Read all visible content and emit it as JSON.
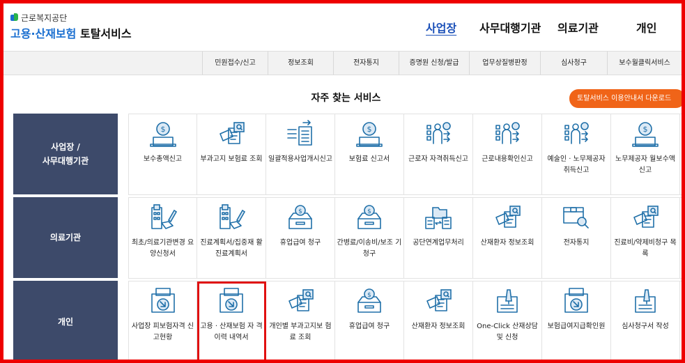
{
  "header": {
    "org": "근로복지공단",
    "service_blue": "고용·산재보험",
    "service_dark": "토탈서비스",
    "nav": [
      {
        "label": "사업장",
        "active": true
      },
      {
        "label": "사무대행기관",
        "active": false
      },
      {
        "label": "의료기관",
        "active": false
      },
      {
        "label": "개인",
        "active": false
      }
    ]
  },
  "subnav": [
    "민원접수/신고",
    "정보조회",
    "전자통지",
    "증명원 신청/발급",
    "업무상질병판정",
    "심사청구",
    "보수월클릭서비스"
  ],
  "frequent": {
    "title": "자주 찾는 서비스",
    "download_label": "토탈서비스 이용안내서 다운로드"
  },
  "colors": {
    "accent_orange": "#f06418",
    "category_bg": "#3d4a6a",
    "icon_blue": "#1f6fa8",
    "highlight_red": "#e01010"
  },
  "rows": [
    {
      "category": "사업장 /\n사무대행기관",
      "items": [
        {
          "label": "보수총액신고",
          "icon": "money-box-icon"
        },
        {
          "label": "부과고지 보험료 조회",
          "icon": "document-search-icon"
        },
        {
          "label": "일괄적용사업개시신고",
          "icon": "document-transfer-icon"
        },
        {
          "label": "보험료 신고서",
          "icon": "money-box-icon"
        },
        {
          "label": "근로자 자격취득신고",
          "icon": "person-list-icon"
        },
        {
          "label": "근로내용확인신고",
          "icon": "person-list-icon"
        },
        {
          "label": "예술인 · 노무제공자 취득신고",
          "icon": "person-list-icon"
        },
        {
          "label": "노무제공자 월보수액 신고",
          "icon": "money-box-icon"
        }
      ]
    },
    {
      "category": "의료기관",
      "items": [
        {
          "label": "최초/의료기관변경 요양신청서",
          "icon": "hospital-form-icon"
        },
        {
          "label": "진료계획서/집중재 활진료계획서",
          "icon": "hospital-form-icon"
        },
        {
          "label": "휴업급여 청구",
          "icon": "coin-tray-icon"
        },
        {
          "label": "간병료/이송비/보조 기 청구",
          "icon": "coin-tray-icon"
        },
        {
          "label": "공단연계업무처리",
          "icon": "folder-exchange-icon"
        },
        {
          "label": "산재환자 정보조회",
          "icon": "document-search-icon"
        },
        {
          "label": "전자통지",
          "icon": "box-search-icon"
        },
        {
          "label": "진료비/약제비청구 목록",
          "icon": "document-search-icon"
        }
      ]
    },
    {
      "category": "개인",
      "items": [
        {
          "label": "사업장 피보험자격 신고현황",
          "icon": "printer-download-icon"
        },
        {
          "label": "고용 · 산재보험 자 격 이력 내역서",
          "icon": "printer-download-icon",
          "highlighted": true
        },
        {
          "label": "개인별 부과고지보 험료 조회",
          "icon": "document-search-icon"
        },
        {
          "label": "휴업급여 청구",
          "icon": "coin-tray-icon"
        },
        {
          "label": "산재환자 정보조회",
          "icon": "document-search-icon"
        },
        {
          "label": "One-Click 산재상담 및 신청",
          "icon": "pen-document-icon"
        },
        {
          "label": "보험급여지급확인원",
          "icon": "printer-download-icon"
        },
        {
          "label": "심사청구서 작성",
          "icon": "pen-document-icon"
        }
      ]
    }
  ]
}
